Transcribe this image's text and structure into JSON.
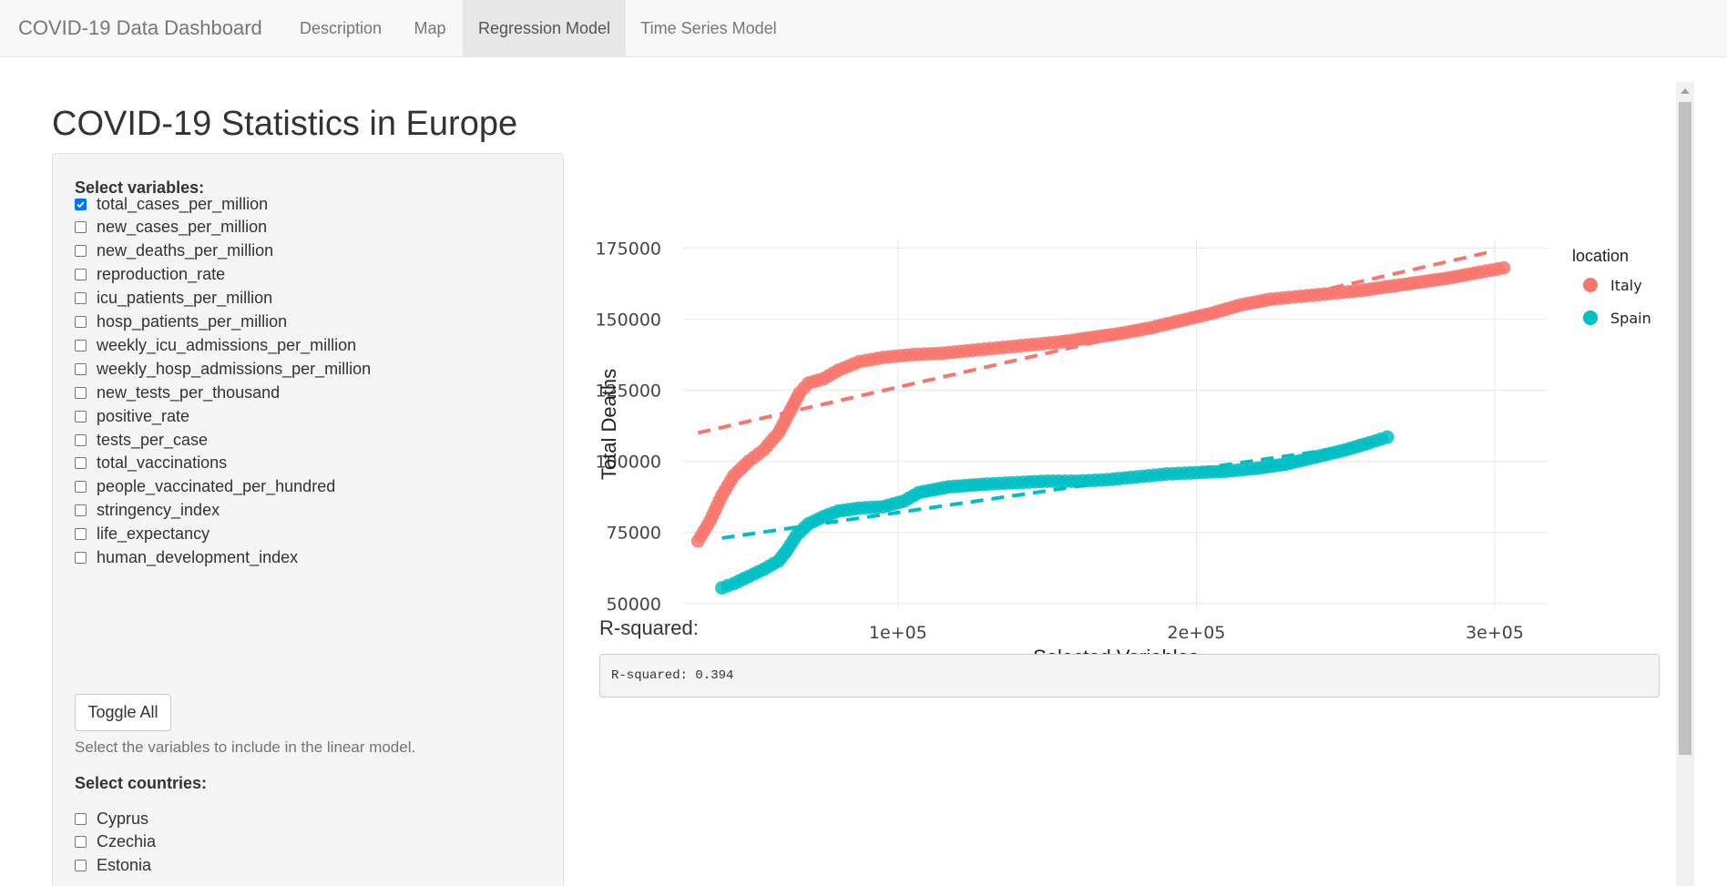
{
  "navbar": {
    "brand": "COVID-19 Data Dashboard",
    "tabs": [
      {
        "label": "Description"
      },
      {
        "label": "Map"
      },
      {
        "label": "Regression Model",
        "active": true
      },
      {
        "label": "Time Series Model"
      }
    ]
  },
  "page": {
    "title": "COVID-19 Statistics in Europe"
  },
  "sidebar": {
    "variables_label": "Select variables:",
    "variables": [
      {
        "label": "total_cases_per_million",
        "checked": true
      },
      {
        "label": "new_cases_per_million",
        "checked": false
      },
      {
        "label": "new_deaths_per_million",
        "checked": false
      },
      {
        "label": "reproduction_rate",
        "checked": false
      },
      {
        "label": "icu_patients_per_million",
        "checked": false
      },
      {
        "label": "hosp_patients_per_million",
        "checked": false
      },
      {
        "label": "weekly_icu_admissions_per_million",
        "checked": false
      },
      {
        "label": "weekly_hosp_admissions_per_million",
        "checked": false
      },
      {
        "label": "new_tests_per_thousand",
        "checked": false
      },
      {
        "label": "positive_rate",
        "checked": false
      },
      {
        "label": "tests_per_case",
        "checked": false
      },
      {
        "label": "total_vaccinations",
        "checked": false
      },
      {
        "label": "people_vaccinated_per_hundred",
        "checked": false
      },
      {
        "label": "stringency_index",
        "checked": false
      },
      {
        "label": "life_expectancy",
        "checked": false
      },
      {
        "label": "human_development_index",
        "checked": false
      }
    ],
    "toggle_all_label": "Toggle All",
    "help_text": "Select the variables to include in the linear model.",
    "countries_label": "Select countries:",
    "countries": [
      {
        "label": "Cyprus",
        "checked": false
      },
      {
        "label": "Czechia",
        "checked": false
      },
      {
        "label": "Estonia",
        "checked": false
      }
    ]
  },
  "chart_data": {
    "type": "scatter",
    "xlabel": "Selected Variables",
    "ylabel": "Total Deaths",
    "xlim": [
      28000,
      318000
    ],
    "ylim": [
      48000,
      178000
    ],
    "x_ticks": [
      100000,
      200000,
      300000
    ],
    "x_tick_labels": [
      "1e+05",
      "2e+05",
      "3e+05"
    ],
    "y_ticks": [
      50000,
      75000,
      100000,
      125000,
      150000,
      175000
    ],
    "y_tick_labels": [
      "50000",
      "75000",
      "100000",
      "125000",
      "150000",
      "175000"
    ],
    "legend_title": "location",
    "legend_position": "right",
    "grid": true,
    "series": [
      {
        "name": "Italy",
        "color": "#f8766d",
        "points": [
          [
            33000,
            72000
          ],
          [
            37000,
            79000
          ],
          [
            41000,
            88000
          ],
          [
            45000,
            95000
          ],
          [
            50000,
            100000
          ],
          [
            55000,
            104000
          ],
          [
            60000,
            110000
          ],
          [
            64000,
            118000
          ],
          [
            67000,
            124000
          ],
          [
            70000,
            127500
          ],
          [
            75000,
            129000
          ],
          [
            80000,
            132000
          ],
          [
            87000,
            135000
          ],
          [
            95000,
            136500
          ],
          [
            105000,
            137500
          ],
          [
            115000,
            138000
          ],
          [
            125000,
            139000
          ],
          [
            135000,
            140000
          ],
          [
            145000,
            141000
          ],
          [
            155000,
            142000
          ],
          [
            165000,
            143500
          ],
          [
            175000,
            145000
          ],
          [
            185000,
            147000
          ],
          [
            195000,
            149500
          ],
          [
            205000,
            152000
          ],
          [
            215000,
            155000
          ],
          [
            225000,
            157000
          ],
          [
            235000,
            158000
          ],
          [
            245000,
            159000
          ],
          [
            255000,
            160000
          ],
          [
            265000,
            161500
          ],
          [
            275000,
            163000
          ],
          [
            285000,
            164500
          ],
          [
            295000,
            166500
          ],
          [
            303000,
            168000
          ]
        ],
        "fit": [
          [
            33000,
            110000
          ],
          [
            300000,
            174000
          ]
        ]
      },
      {
        "name": "Spain",
        "color": "#00bfc4",
        "points": [
          [
            41000,
            55500
          ],
          [
            45000,
            57000
          ],
          [
            50000,
            59500
          ],
          [
            55000,
            62000
          ],
          [
            60000,
            65000
          ],
          [
            63000,
            69000
          ],
          [
            66000,
            74000
          ],
          [
            70000,
            78000
          ],
          [
            75000,
            80500
          ],
          [
            80000,
            82500
          ],
          [
            87000,
            83500
          ],
          [
            95000,
            84000
          ],
          [
            102000,
            86000
          ],
          [
            107000,
            89000
          ],
          [
            112000,
            90000
          ],
          [
            117000,
            91000
          ],
          [
            130000,
            92000
          ],
          [
            140000,
            92500
          ],
          [
            150000,
            93000
          ],
          [
            160000,
            93000
          ],
          [
            170000,
            93500
          ],
          [
            180000,
            94500
          ],
          [
            190000,
            95500
          ],
          [
            200000,
            96000
          ],
          [
            210000,
            96500
          ],
          [
            220000,
            97500
          ],
          [
            230000,
            99000
          ],
          [
            240000,
            101500
          ],
          [
            250000,
            104000
          ],
          [
            258000,
            106500
          ],
          [
            264000,
            108500
          ]
        ],
        "fit": [
          [
            41000,
            73000
          ],
          [
            264000,
            107000
          ]
        ]
      }
    ]
  },
  "results": {
    "rsq_label": "R-squared:",
    "rsq_output": "R-squared: 0.394"
  },
  "icons": {
    "checkmark": "check-icon",
    "scroll_up": "chevron-up-icon"
  }
}
